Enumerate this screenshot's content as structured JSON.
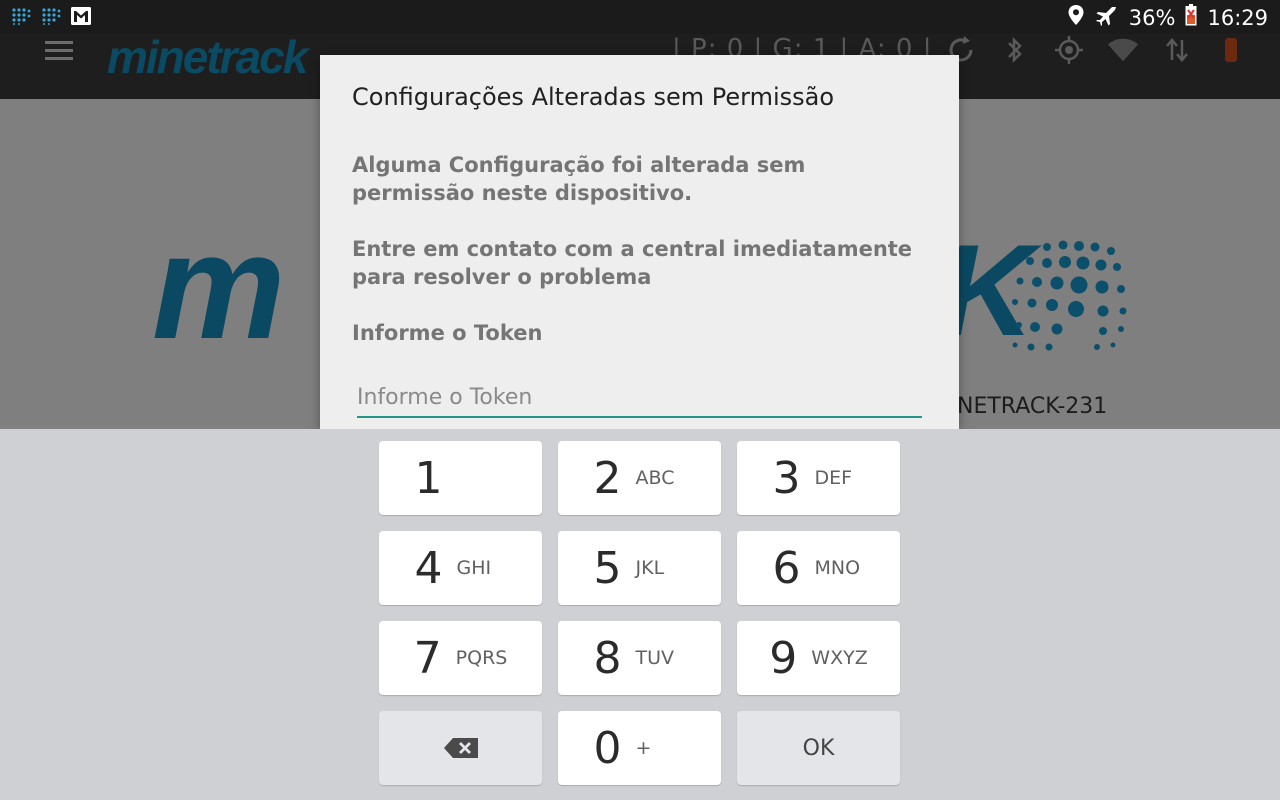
{
  "status_bar": {
    "battery": "36%",
    "time": "16:29"
  },
  "toolbar": {
    "logo_text": "minetrack",
    "counters": "| P: 0 | G: 1 | A: 0 |"
  },
  "content": {
    "logo_text": "m",
    "logo_tail": "K",
    "device_id": "NETRACK-231"
  },
  "dialog": {
    "title": "Configurações Alteradas sem Permissão",
    "message1": "Alguma Configuração foi alterada sem permissão neste dispositivo.",
    "message2": "Entre em contato com a central imediatamente para resolver o problema",
    "token_label": "Informe o Token",
    "token_placeholder": "Informe o Token",
    "token_value": ""
  },
  "keypad": {
    "keys": [
      {
        "num": "1",
        "sub": ""
      },
      {
        "num": "2",
        "sub": "ABC"
      },
      {
        "num": "3",
        "sub": "DEF"
      },
      {
        "num": "4",
        "sub": "GHI"
      },
      {
        "num": "5",
        "sub": "JKL"
      },
      {
        "num": "6",
        "sub": "MNO"
      },
      {
        "num": "7",
        "sub": "PQRS"
      },
      {
        "num": "8",
        "sub": "TUV"
      },
      {
        "num": "9",
        "sub": "WXYZ"
      },
      {
        "num": "0",
        "sub": "+"
      }
    ],
    "ok_label": "OK"
  },
  "colors": {
    "accent": "#26958a",
    "brand": "#0b4962"
  }
}
